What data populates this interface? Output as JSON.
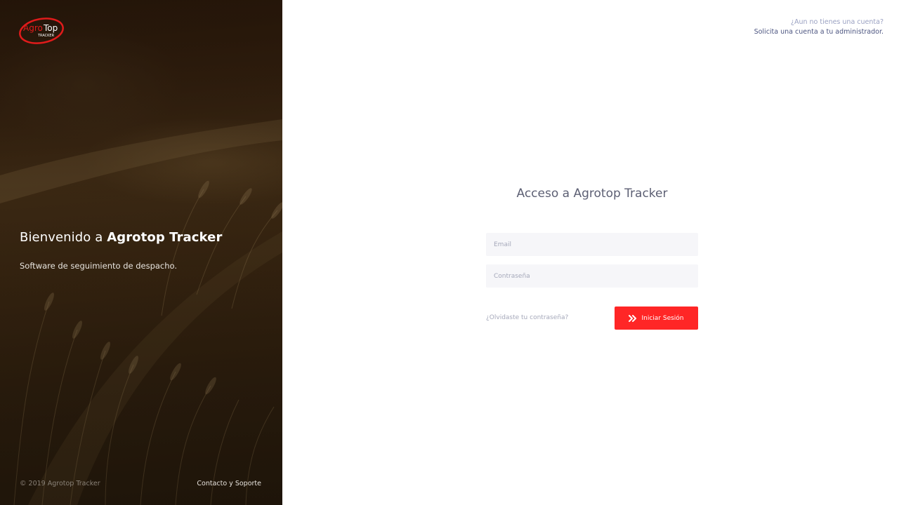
{
  "hero": {
    "logo_text_agro": "Agro",
    "logo_text_top": "Top",
    "logo_text_tracker": "TRACKER",
    "welcome_prefix": "Bienvenido a ",
    "welcome_brand": "Agrotop Tracker",
    "subtitle": "Software de seguimiento de despacho.",
    "copyright": "© 2019 Agrotop Tracker",
    "contact_link": "Contacto y Soporte"
  },
  "signup_prompt": {
    "question": "¿Aun no tienes una cuenta?",
    "action": "Solicita una cuenta a tu administrador."
  },
  "login": {
    "title": "Acceso a Agrotop Tracker",
    "email_placeholder": "Email",
    "password_placeholder": "Contraseña",
    "forgot_link": "¿Olvidaste tu contraseña?",
    "submit_label": "Iniciar Sesión",
    "submit_icon": "double-chevron-right-icon"
  },
  "colors": {
    "accent": "#ff2626",
    "title_text": "#5c5f73",
    "muted_text": "#a5a8ba",
    "input_bg": "#f6f6f9"
  }
}
